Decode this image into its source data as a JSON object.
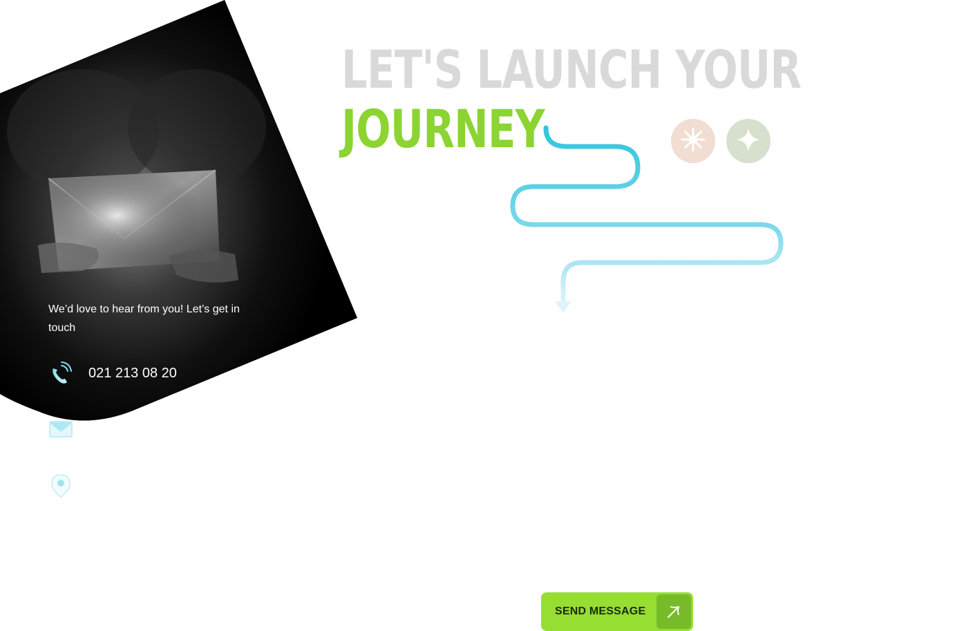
{
  "heading": {
    "line1": "LET'S LAUNCH YOUR",
    "line2": "JOURNEY"
  },
  "contact": {
    "intro": "We’d love to hear from  you! Let’s get in touch",
    "phone": "021 213 08 20",
    "email": "",
    "location": ""
  },
  "actions": {
    "send_label": "SEND MESSAGE"
  },
  "icons": {
    "phone": "phone-ringing-icon",
    "email": "envelope-icon",
    "location": "map-pin-icon",
    "badge1": "sparkle-burst-icon",
    "badge2": "four-point-star-icon",
    "send": "arrow-up-right-icon"
  },
  "colors": {
    "accent_green": "#8bd432",
    "button_green": "#97de32",
    "button_dark_green": "#78bb2a",
    "heading_gray": "#d9d9d9",
    "path_cyan": "#2ec5dc",
    "badge_peach": "#f2ddd3",
    "badge_sage": "#d6e0cc"
  }
}
